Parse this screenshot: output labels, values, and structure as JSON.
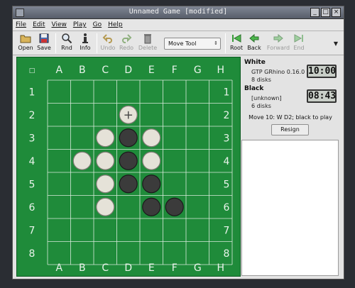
{
  "window": {
    "title": "Unnamed Game [modified]",
    "minimize": "_",
    "maximize": "□",
    "close": "×"
  },
  "menu": {
    "file": "File",
    "edit": "Edit",
    "view": "View",
    "play": "Play",
    "go": "Go",
    "help": "Help"
  },
  "toolbar": {
    "open": "Open",
    "save": "Save",
    "rnd": "Rnd",
    "info": "Info",
    "undo": "Undo",
    "redo": "Redo",
    "delete": "Delete",
    "tool_select": "Move Tool",
    "root": "Root",
    "back": "Back",
    "forward": "Forward",
    "end": "End",
    "more": "▼"
  },
  "board": {
    "corner": "□",
    "columns": [
      "A",
      "B",
      "C",
      "D",
      "E",
      "F",
      "G",
      "H"
    ],
    "rows": [
      "1",
      "2",
      "3",
      "4",
      "5",
      "6",
      "7",
      "8"
    ],
    "pieces": [
      {
        "sq": "C3",
        "color": "white"
      },
      {
        "sq": "D3",
        "color": "black"
      },
      {
        "sq": "E3",
        "color": "white"
      },
      {
        "sq": "B4",
        "color": "white"
      },
      {
        "sq": "C4",
        "color": "white"
      },
      {
        "sq": "D4",
        "color": "black"
      },
      {
        "sq": "E4",
        "color": "white"
      },
      {
        "sq": "C5",
        "color": "white"
      },
      {
        "sq": "D5",
        "color": "black"
      },
      {
        "sq": "E5",
        "color": "black"
      },
      {
        "sq": "C6",
        "color": "white"
      },
      {
        "sq": "E6",
        "color": "black"
      },
      {
        "sq": "F6",
        "color": "black"
      }
    ],
    "last_move": {
      "sq": "D2",
      "color": "white",
      "marker": "+"
    },
    "colors": {
      "board": "#1f8b3a",
      "white_disk": "#e5e2d8",
      "black_disk": "#3b3b3b"
    }
  },
  "players": {
    "white": {
      "label": "White",
      "name": "GTP GRhino 0.16.0",
      "disks": "8 disks",
      "clock": "10:00"
    },
    "black": {
      "label": "Black",
      "name": "[unknown]",
      "disks": "6 disks",
      "clock": "08:43"
    }
  },
  "status": "Move 10: W D2; black to play",
  "resign": "Resign"
}
